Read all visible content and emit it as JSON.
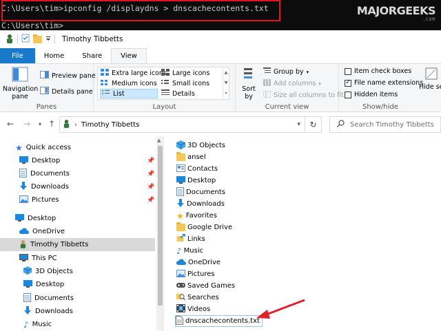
{
  "terminal": {
    "command_line": "C:\\Users\\tim>ipconfig /displaydns > dnscachecontents.txt",
    "prompt_line": "C:\\Users\\tim>"
  },
  "watermark": {
    "main": "MAJORGEEKS",
    "sub": ".COM"
  },
  "window": {
    "title": "Timothy Tibbetts"
  },
  "ribbon": {
    "tabs": [
      "File",
      "Home",
      "Share",
      "View"
    ],
    "active_tab": "View",
    "panes": {
      "label": "Panes",
      "navigation_pane": "Navigation pane",
      "preview_pane": "Preview pane",
      "details_pane": "Details pane"
    },
    "layout": {
      "label": "Layout",
      "extra_large_icons": "Extra large icons",
      "large_icons": "Large icons",
      "medium_icons": "Medium icons",
      "small_icons": "Small icons",
      "list": "List",
      "details": "Details",
      "selected": "List"
    },
    "current_view": {
      "label": "Current view",
      "sort_by": "Sort by",
      "group_by": "Group by",
      "add_columns": "Add columns",
      "size_all_columns": "Size all columns to fit"
    },
    "show_hide": {
      "label": "Show/hide",
      "item_check_boxes": "Item check boxes",
      "item_check_boxes_checked": false,
      "file_name_extensions": "File name extensions",
      "file_name_extensions_checked": true,
      "hidden_items": "Hidden items",
      "hidden_items_checked": false,
      "hide_selected": "Hide se"
    }
  },
  "address": {
    "path": "Timothy Tibbetts",
    "search_placeholder": "Search Timothy Tibbetts"
  },
  "nav_pane": {
    "quick_access": "Quick access",
    "quick_items": [
      "Desktop",
      "Documents",
      "Downloads",
      "Pictures"
    ],
    "desktop": "Desktop",
    "onedrive": "OneDrive",
    "user": "Timothy Tibbetts",
    "this_pc": "This PC",
    "pc_items": [
      "3D Objects",
      "Desktop",
      "Documents",
      "Downloads",
      "Music"
    ],
    "selected": "Timothy Tibbetts"
  },
  "files": [
    "3D Objects",
    "ansel",
    "Contacts",
    "Desktop",
    "Documents",
    "Downloads",
    "Favorites",
    "Google Drive",
    "Links",
    "Music",
    "OneDrive",
    "Pictures",
    "Saved Games",
    "Searches",
    "Videos",
    "dnscachecontents.txt"
  ],
  "highlighted_file": "dnscachecontents.txt",
  "colors": {
    "file_tab": "#1979ca",
    "cmd_highlight": "#e6121c",
    "arrow": "#e0202a"
  }
}
